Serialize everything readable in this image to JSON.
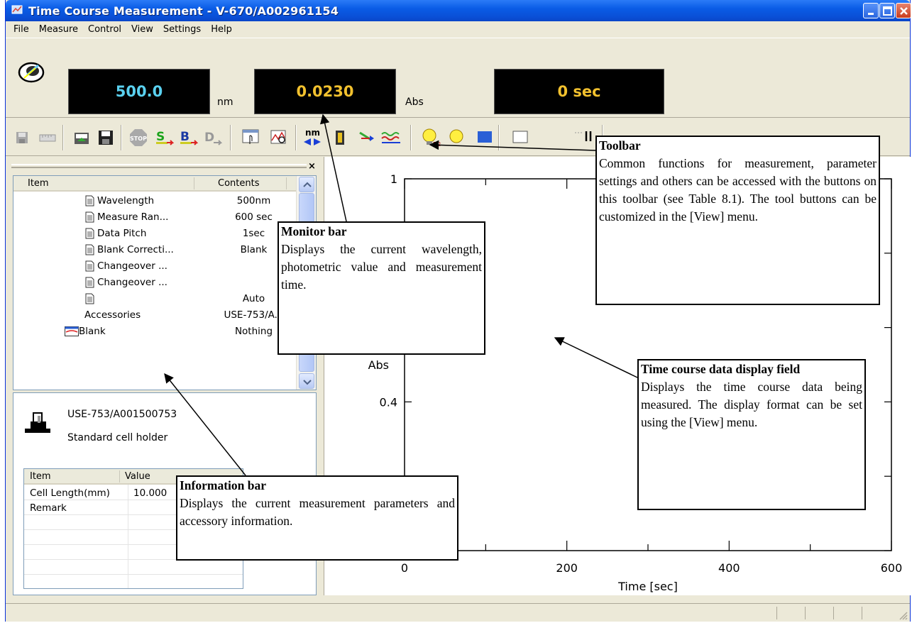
{
  "window": {
    "title": "Time Course Measurement - V-670/A002961154"
  },
  "menu": [
    "File",
    "Measure",
    "Control",
    "View",
    "Settings",
    "Help"
  ],
  "monitor": {
    "wavelength": "500.0",
    "wavelength_unit": "nm",
    "photometric": "0.0230",
    "photometric_unit": "Abs",
    "time": "0 sec"
  },
  "toolbar": {
    "buttons": [
      "save",
      "ruler",
      "open-folder",
      "save-disk",
      "stop",
      "sample",
      "blank",
      "print",
      "data-window",
      "spectrum-view",
      "wavelength-nm",
      "cell",
      "arrow-tool",
      "baseline",
      "lamp",
      "lamp2"
    ],
    "nm_label": "nm"
  },
  "infobar": {
    "header_item": "Item",
    "header_contents": "Contents",
    "rows": [
      {
        "item": "Wavelength",
        "contents": "500nm"
      },
      {
        "item": "Measure Ran...",
        "contents": "600 sec"
      },
      {
        "item": "Data Pitch",
        "contents": "1sec"
      },
      {
        "item": "Blank Correcti...",
        "contents": "Blank"
      },
      {
        "item": "Changeover ...",
        "contents": ""
      },
      {
        "item": "Changeover ...",
        "contents": ""
      },
      {
        "item": "",
        "contents": "Auto"
      },
      {
        "item": "Accessories",
        "contents": "USE-753/A..."
      },
      {
        "item": "Blank",
        "contents": "Nothing"
      }
    ],
    "accessory_name": "USE-753/A001500753",
    "accessory_desc": "Standard cell holder",
    "acc_header_item": "Item",
    "acc_header_value": "Value",
    "acc_rows": [
      {
        "item": "Cell Length(mm)",
        "value": "10.000"
      },
      {
        "item": "Remark",
        "value": ""
      }
    ]
  },
  "chart_data": {
    "type": "line",
    "series": [],
    "xlabel": "Time [sec]",
    "ylabel": "Abs",
    "xlim": [
      0,
      600
    ],
    "ylim": [
      0,
      1
    ],
    "x_tick_labels": [
      "0",
      "200",
      "400",
      "600"
    ],
    "y_tick_labels": [
      "1",
      "0.4"
    ]
  },
  "callouts": {
    "toolbar": {
      "title": "Toolbar",
      "text": "Common functions for measurement, parameter settings and others can be accessed with the buttons on this toolbar (see Table 8.1). The tool buttons can be customized in the [View] menu."
    },
    "monitor": {
      "title": "Monitor bar",
      "text": "Displays the current wavelength, photometric value and measurement time."
    },
    "display": {
      "title": "Time course data display field",
      "text": "Displays the time course data being measured. The display format can be set using the [View] menu."
    },
    "info": {
      "title": "Information bar",
      "text": "Displays the current measurement parameters and accessory information."
    }
  }
}
